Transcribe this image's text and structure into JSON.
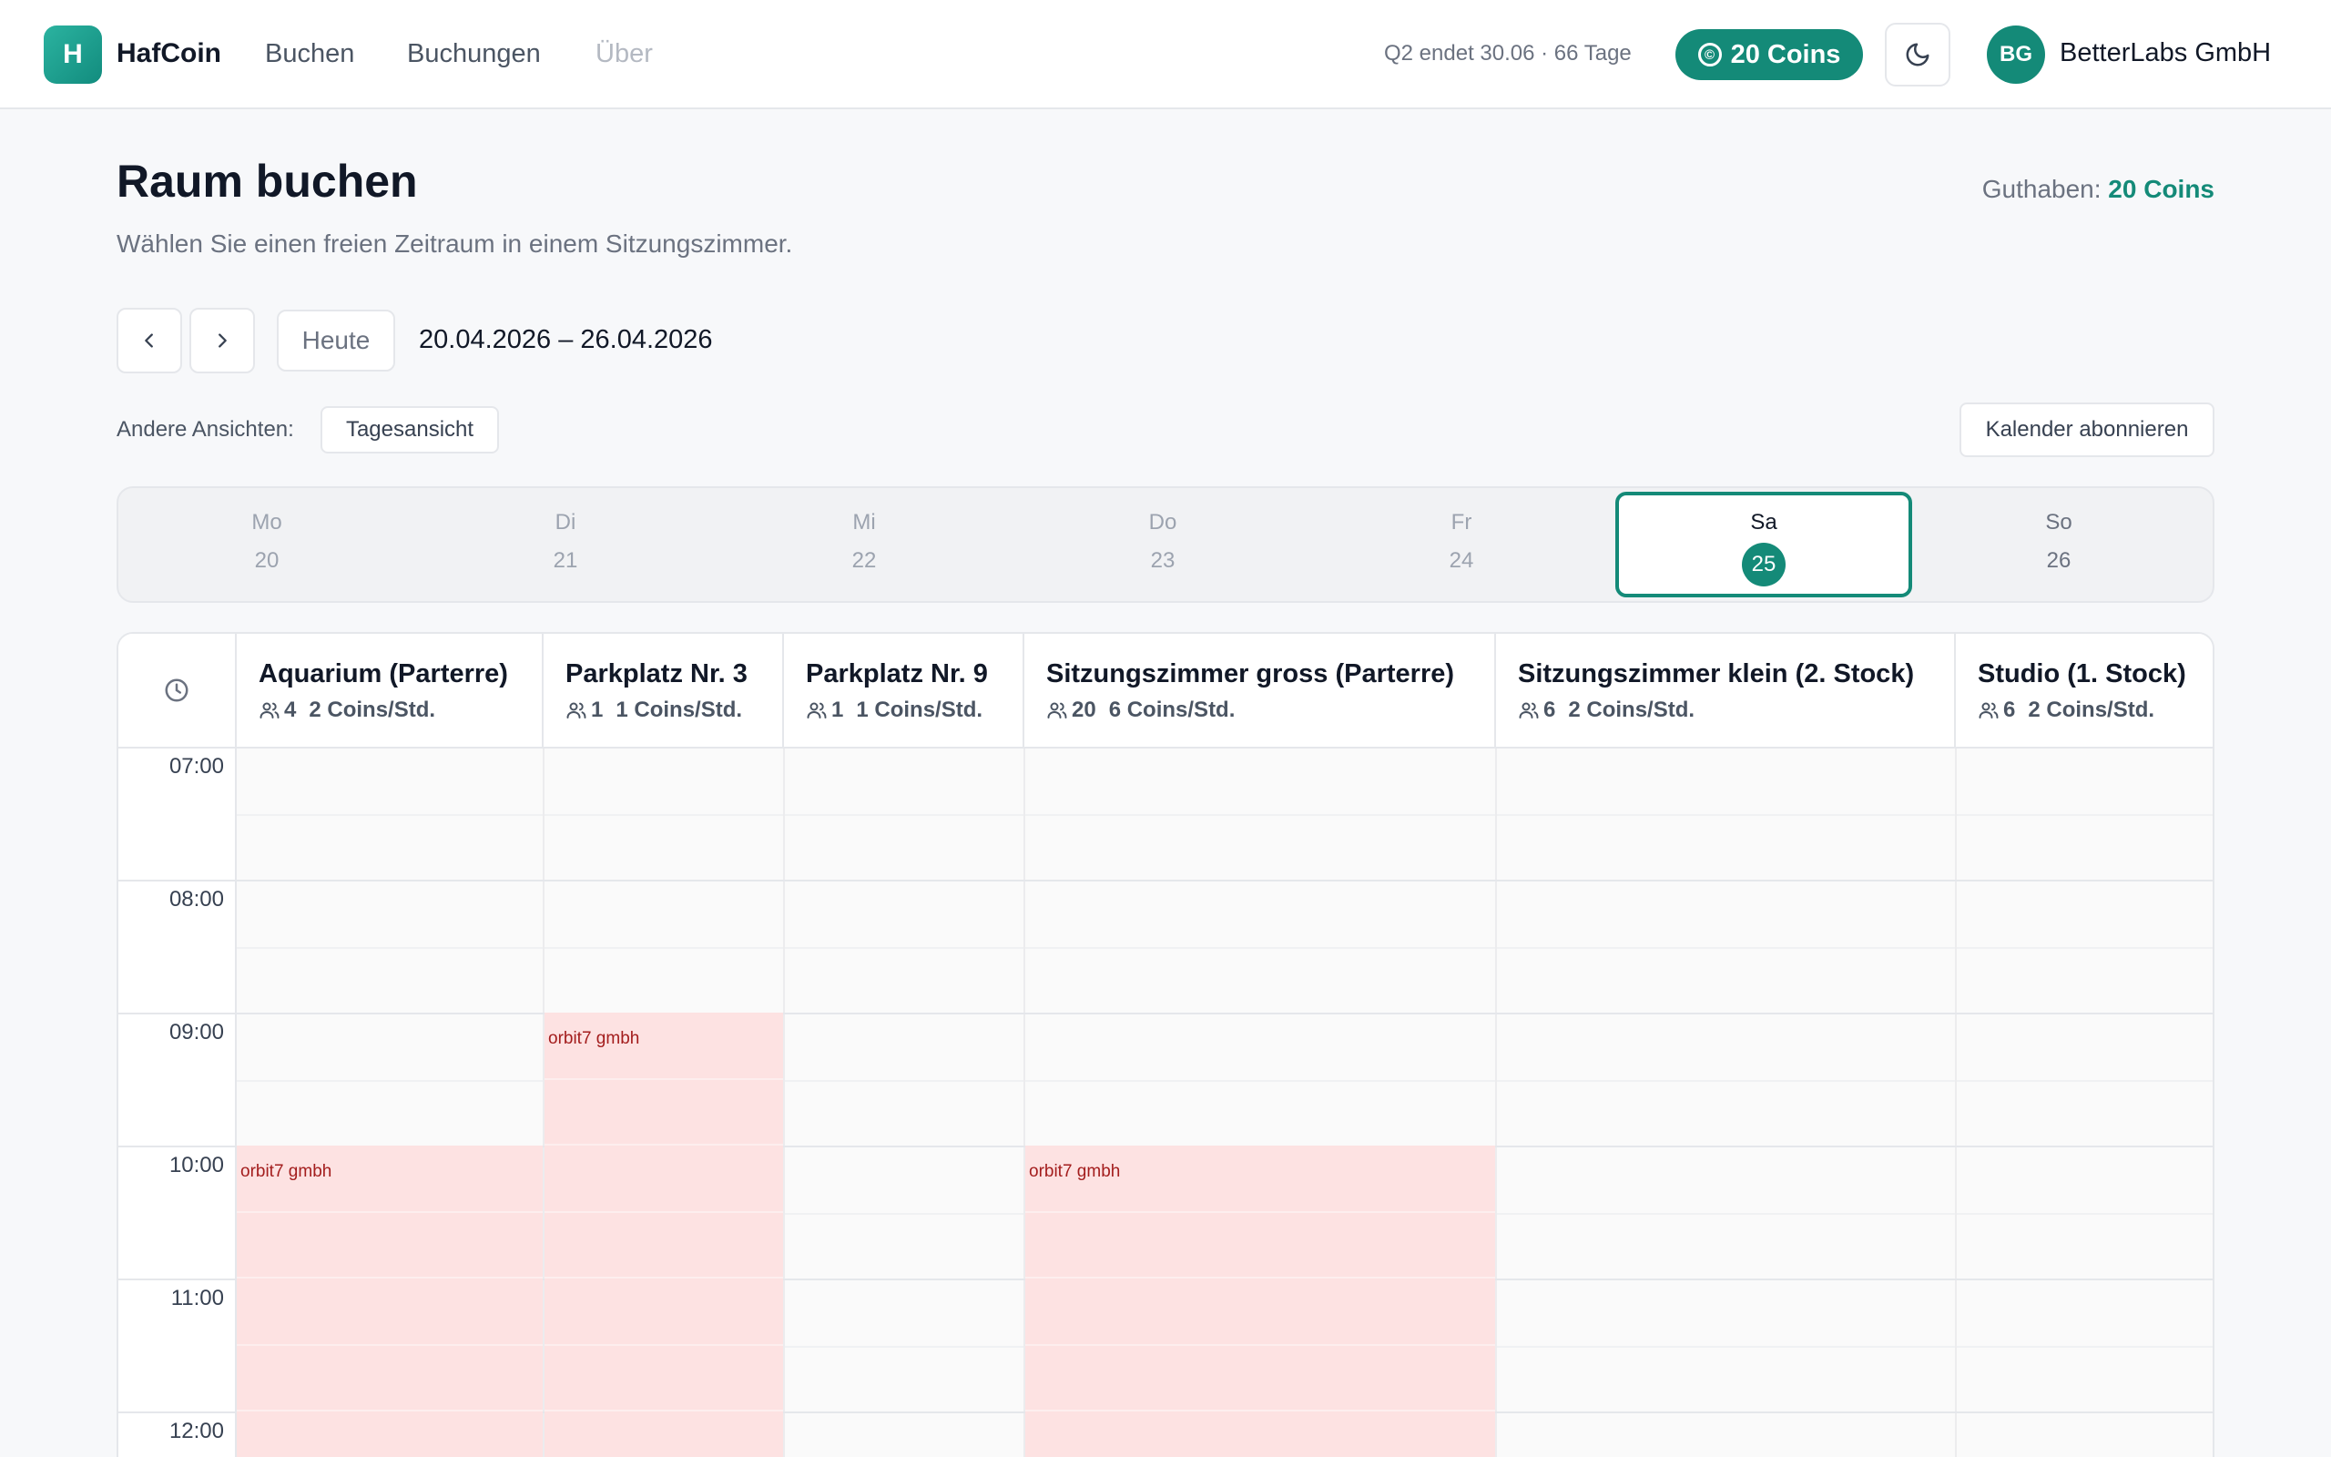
{
  "nav": {
    "logo_letter": "H",
    "brand": "HafCoin",
    "links": [
      "Buchen",
      "Buchungen",
      "Über"
    ],
    "quarter_info": "Q2 endet 30.06 · 66 Tage",
    "coins_label": "20 Coins",
    "coin_icon_glyph": "©",
    "avatar_initials": "BG",
    "company": "BetterLabs GmbH",
    "accent_color": "#148a78"
  },
  "header": {
    "title": "Raum buchen",
    "subtitle": "Wählen Sie einen freien Zeitraum in einem Sitzungszimmer.",
    "balance_label": "Guthaben:",
    "balance_value": "20 Coins"
  },
  "toolbar": {
    "today_label": "Heute",
    "range": "20.04.2026 – 26.04.2026",
    "views_label": "Andere Ansichten:",
    "day_view_label": "Tagesansicht",
    "subscribe_label": "Kalender abonnieren"
  },
  "days": [
    {
      "name": "Mo",
      "num": "20"
    },
    {
      "name": "Di",
      "num": "21"
    },
    {
      "name": "Mi",
      "num": "22"
    },
    {
      "name": "Do",
      "num": "23"
    },
    {
      "name": "Fr",
      "num": "24"
    },
    {
      "name": "Sa",
      "num": "25",
      "selected": true
    },
    {
      "name": "So",
      "num": "26"
    }
  ],
  "rooms": [
    {
      "name": "Aquarium (Parterre)",
      "capacity": "4",
      "rate": "2 Coins/Std."
    },
    {
      "name": "Parkplatz Nr. 3",
      "capacity": "1",
      "rate": "1 Coins/Std."
    },
    {
      "name": "Parkplatz Nr. 9",
      "capacity": "1",
      "rate": "1 Coins/Std."
    },
    {
      "name": "Sitzungszimmer gross (Parterre)",
      "capacity": "20",
      "rate": "6 Coins/Std."
    },
    {
      "name": "Sitzungszimmer klein (2. Stock)",
      "capacity": "6",
      "rate": "2 Coins/Std."
    },
    {
      "name": "Studio (1. Stock)",
      "capacity": "6",
      "rate": "2 Coins/Std."
    }
  ],
  "hours": [
    "07:00",
    "08:00",
    "09:00",
    "10:00",
    "11:00",
    "12:00"
  ],
  "bookings": [
    {
      "room": 0,
      "start": "10:00",
      "label": "orbit7 gmbh"
    },
    {
      "room": 1,
      "start": "09:00",
      "label": "orbit7 gmbh"
    },
    {
      "room": 3,
      "start": "10:00",
      "label": "orbit7 gmbh"
    }
  ],
  "booking_color": "#fde2e2"
}
